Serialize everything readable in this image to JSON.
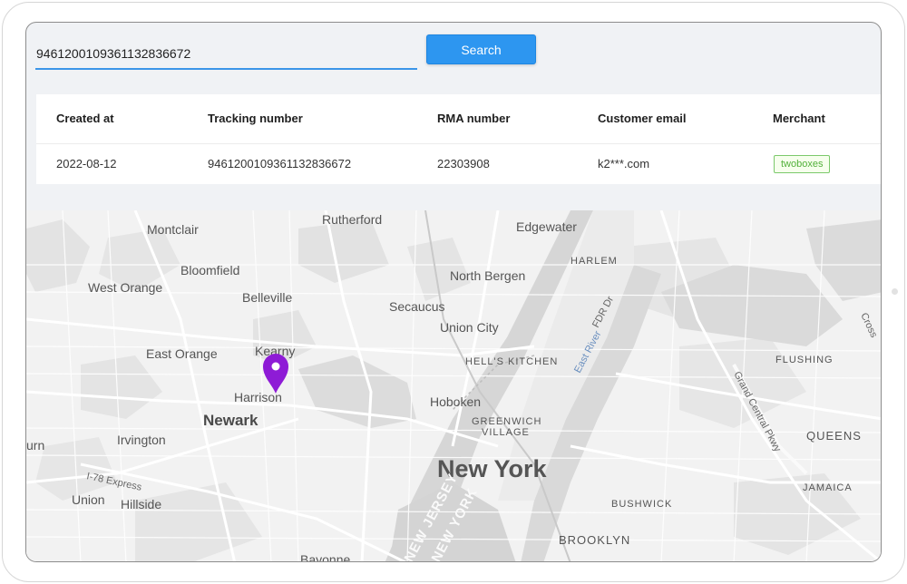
{
  "search": {
    "value": "9461200109361132836672",
    "button_label": "Search"
  },
  "table": {
    "columns": [
      "Created at",
      "Tracking number",
      "RMA number",
      "Customer email",
      "Merchant"
    ],
    "rows": [
      {
        "created_at": "2022-08-12",
        "tracking_number": "9461200109361132836672",
        "rma_number": "22303908",
        "customer_email": "k2***.com",
        "merchant": "twoboxes"
      }
    ]
  },
  "map": {
    "labels": {
      "rutherford": "Rutherford",
      "montclair": "Montclair",
      "edgewater": "Edgewater",
      "harlem": "HARLEM",
      "bloomfield": "Bloomfield",
      "north_bergen": "North Bergen",
      "west_orange": "West Orange",
      "belleville": "Belleville",
      "secaucus": "Secaucus",
      "fdr_dr": "FDR Dr",
      "cross": "Cross",
      "union_city": "Union City",
      "east_orange": "East Orange",
      "kearny": "Kearny",
      "hells_kitchen": "HELL'S KITCHEN",
      "east_river": "East River",
      "flushing": "FLUSHING",
      "harrison": "Harrison",
      "hoboken": "Hoboken",
      "grand_central": "Grand Central Pkwy",
      "newark": "Newark",
      "greenwich": "GREENWICH",
      "village": "VILLAGE",
      "queens": "QUEENS",
      "irvington": "Irvington",
      "urn": "urn",
      "new_york": "New York",
      "i78": "I-78 Express",
      "union": "Union",
      "hillside": "Hillside",
      "jamaica": "JAMAICA",
      "bushwick": "BUSHWICK",
      "new_jersey": "NEW JERSEY",
      "new_york_state": "NEW YORK",
      "brooklyn": "BROOKLYN",
      "bayonne": "Bayonne"
    },
    "pin_color": "#8e1bd6"
  }
}
